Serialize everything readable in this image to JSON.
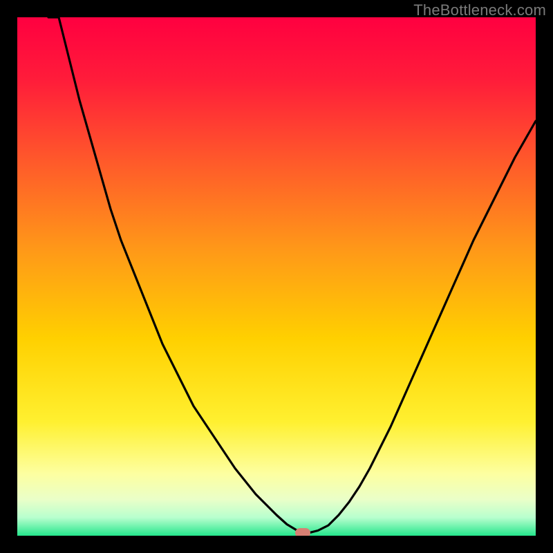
{
  "watermark": "TheBottleneck.com",
  "colors": {
    "gradient_stops": [
      {
        "offset": "0%",
        "color": "#ff0040"
      },
      {
        "offset": "12%",
        "color": "#ff1c3a"
      },
      {
        "offset": "28%",
        "color": "#ff5a2a"
      },
      {
        "offset": "45%",
        "color": "#ff9918"
      },
      {
        "offset": "62%",
        "color": "#ffd000"
      },
      {
        "offset": "78%",
        "color": "#fff030"
      },
      {
        "offset": "88%",
        "color": "#fdffa0"
      },
      {
        "offset": "93%",
        "color": "#eaffc8"
      },
      {
        "offset": "96.5%",
        "color": "#b8ffce"
      },
      {
        "offset": "100%",
        "color": "#25e68c"
      }
    ],
    "curve_stroke": "#000000",
    "marker_fill": "#d77f73",
    "frame_bg": "#000000"
  },
  "chart_data": {
    "type": "line",
    "title": "",
    "xlabel": "",
    "ylabel": "",
    "xlim": [
      0,
      100
    ],
    "ylim": [
      0,
      100
    ],
    "x": [
      0,
      2,
      4,
      6,
      8,
      10,
      12,
      14,
      16,
      18,
      20,
      22,
      24,
      26,
      28,
      30,
      32,
      34,
      36,
      38,
      40,
      42,
      44,
      46,
      48,
      50,
      52,
      54,
      55,
      56,
      58,
      60,
      62,
      64,
      66,
      68,
      70,
      72,
      74,
      76,
      78,
      80,
      82,
      84,
      86,
      88,
      90,
      92,
      94,
      96,
      98,
      100
    ],
    "values": [
      131,
      120,
      109,
      100,
      100,
      92,
      84,
      77,
      70,
      63,
      57,
      52,
      47,
      42,
      37,
      33,
      29,
      25,
      22,
      19,
      16,
      13,
      10.5,
      8,
      6,
      4,
      2.2,
      1,
      0.5,
      0.5,
      1,
      2,
      4,
      6.5,
      9.5,
      13,
      17,
      21,
      25.5,
      30,
      34.5,
      39,
      43.5,
      48,
      52.5,
      57,
      61,
      65,
      69,
      73,
      76.5,
      80
    ],
    "optimum_x": 55,
    "optimum_y": 0.5,
    "note": "x and values are percentages of the plot width/height; values >100 lie above the visible area (curve enters from top-left)."
  }
}
